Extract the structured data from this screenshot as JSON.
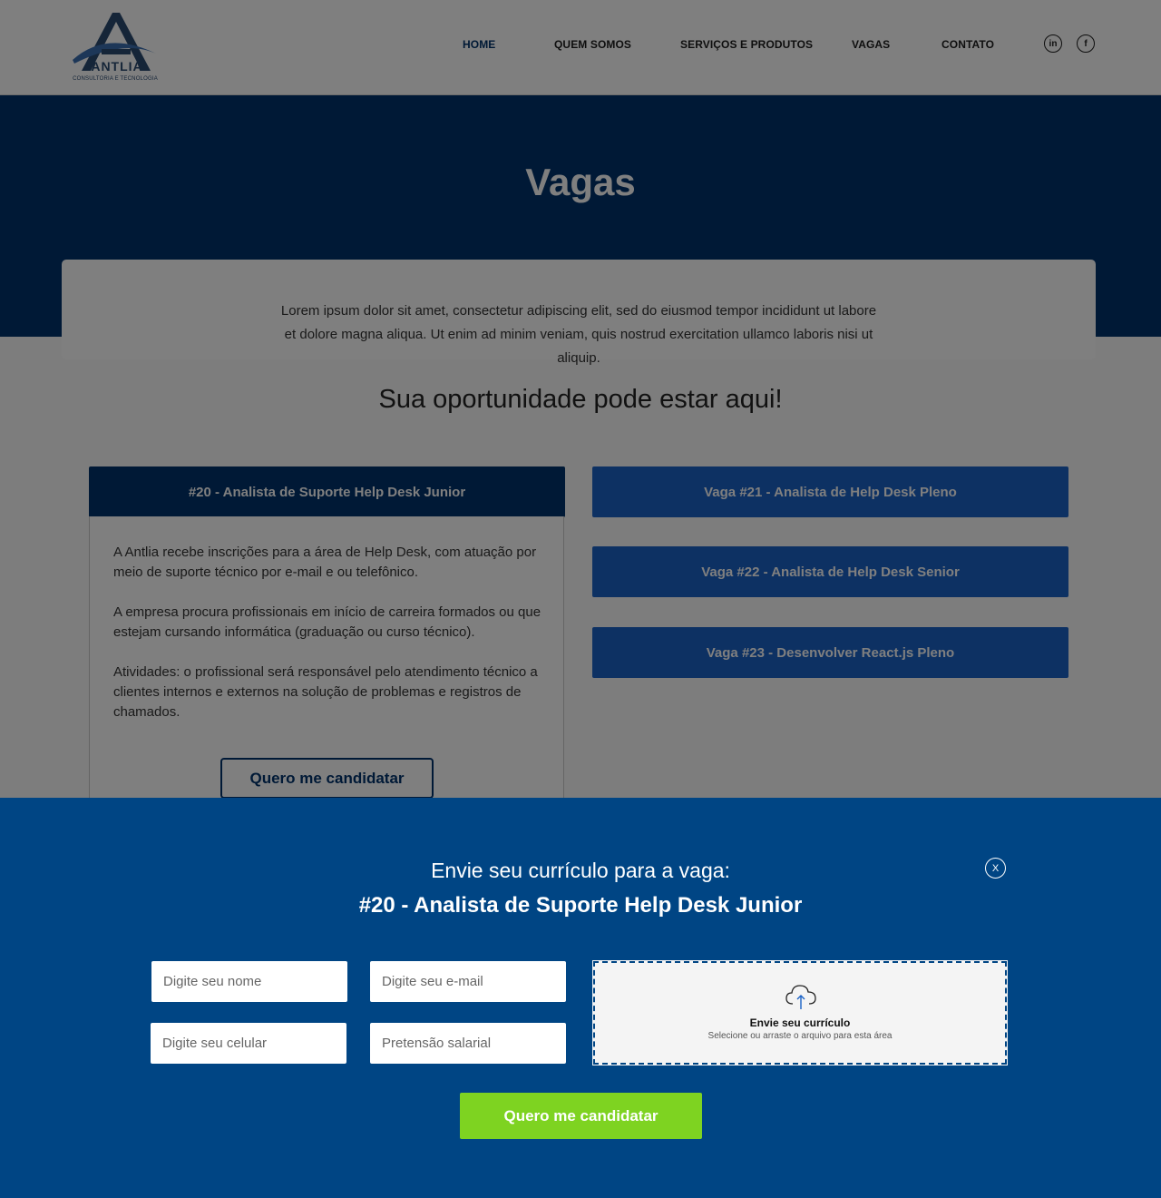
{
  "logo": {
    "name": "ANTLIA",
    "subtitle": "CONSULTORIA E TECNOLOGIA"
  },
  "nav": [
    {
      "label": "HOME",
      "active": true
    },
    {
      "label": "QUEM SOMOS",
      "active": false
    },
    {
      "label": "SERVIÇOS E PRODUTOS",
      "active": false
    },
    {
      "label": "VAGAS",
      "active": false
    },
    {
      "label": "CONTATO",
      "active": false
    }
  ],
  "social": {
    "linkedin": "in",
    "facebook": "f"
  },
  "hero": {
    "title": "Vagas"
  },
  "intro": {
    "text": "Lorem ipsum dolor sit amet, consectetur adipiscing elit, sed do eiusmod tempor incididunt ut labore et dolore magna aliqua. Ut enim ad minim veniam, quis nostrud exercitation ullamco laboris nisi ut aliquip."
  },
  "section_title": "Sua oportunidade pode estar aqui!",
  "jobs": [
    {
      "title": "#20 - Analista de Suporte Help Desk Junior",
      "expanded": true,
      "paragraphs": [
        "A Antlia recebe inscrições para a área de Help Desk, com atuação por meio de suporte técnico por e-mail e ou telefônico.",
        "A empresa procura profissionais em início de carreira formados ou que estejam cursando informática (graduação ou curso técnico).",
        "Atividades: o profissional será responsável pelo atendimento técnico a clientes internos e externos na solução de problemas e registros de chamados."
      ],
      "apply_label": "Quero me candidatar"
    },
    {
      "title": "Vaga #21 - Analista de Help Desk Pleno",
      "expanded": false
    },
    {
      "title": "Vaga #22 - Analista de Help Desk Senior",
      "expanded": false
    },
    {
      "title": "Vaga #23 - Desenvolver React.js Pleno",
      "expanded": false
    }
  ],
  "modal": {
    "heading": "Envie seu currículo para a vaga:",
    "job_title": "#20 - Analista de Suporte Help Desk Junior",
    "close_label": "X",
    "fields": {
      "name_placeholder": "Digite seu nome",
      "email_placeholder": "Digite seu e-mail",
      "phone_placeholder": "Digite seu celular",
      "salary_placeholder": "Pretensão salarial"
    },
    "upload": {
      "title": "Envie seu currículo",
      "hint": "Selecione ou arraste o arquivo para esta área",
      "icon": "cloud-upload-icon"
    },
    "submit_label": "Quero me candidatar"
  },
  "colors": {
    "primary_navy": "#00336d",
    "job_blue": "#1b62c6",
    "modal_blue": "#004584",
    "submit_green": "#7ed321"
  }
}
